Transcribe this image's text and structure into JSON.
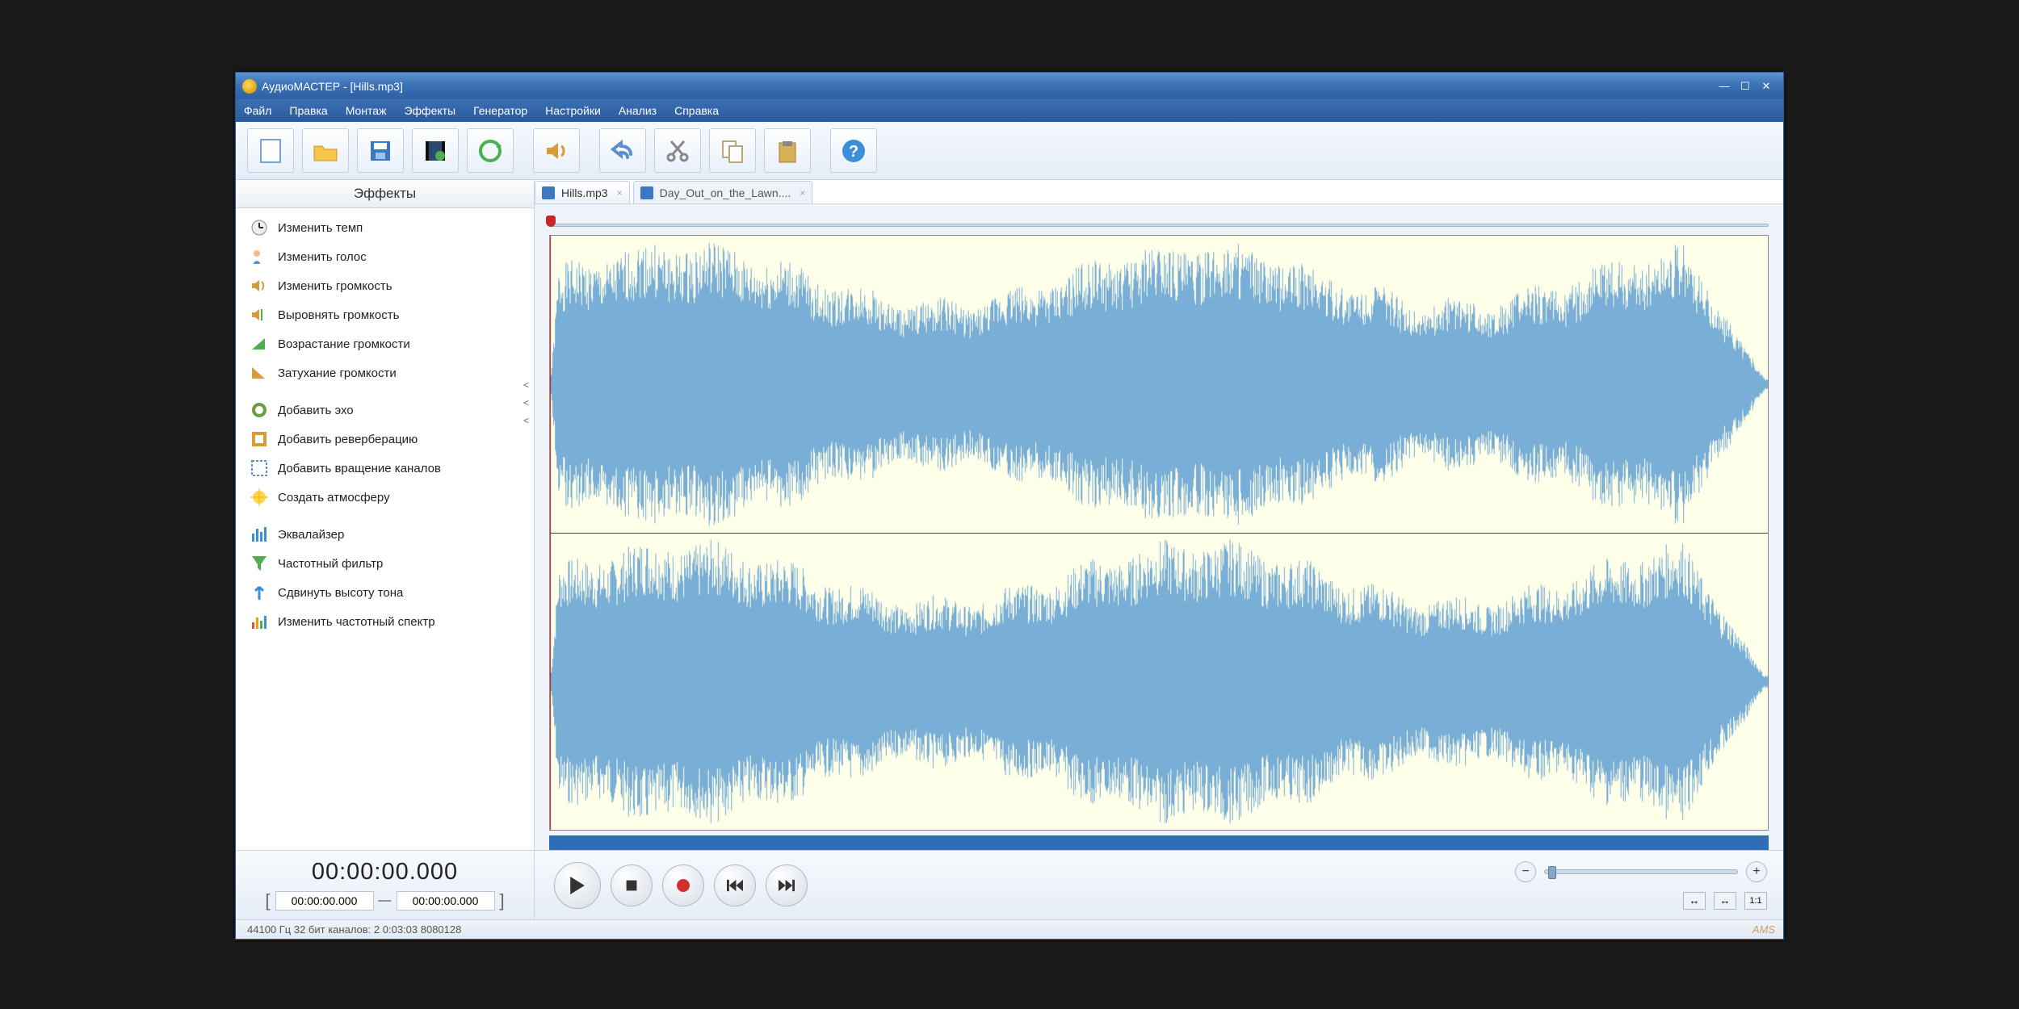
{
  "title": "АудиоМАСТЕР - [Hills.mp3]",
  "menu": [
    "Файл",
    "Правка",
    "Монтаж",
    "Эффекты",
    "Генератор",
    "Настройки",
    "Анализ",
    "Справка"
  ],
  "toolbar_icons": [
    "new",
    "open",
    "save",
    "video",
    "refresh",
    "speaker",
    "undo",
    "cut",
    "copy",
    "paste",
    "help"
  ],
  "sidebar_title": "Эффекты",
  "effects": {
    "g1": [
      {
        "label": "Изменить темп",
        "icon": "clock"
      },
      {
        "label": "Изменить голос",
        "icon": "voice"
      },
      {
        "label": "Изменить громкость",
        "icon": "vol"
      },
      {
        "label": "Выровнять громкость",
        "icon": "volnorm"
      },
      {
        "label": "Возрастание громкости",
        "icon": "fadein"
      },
      {
        "label": "Затухание громкости",
        "icon": "fadeout"
      }
    ],
    "g2": [
      {
        "label": "Добавить эхо",
        "icon": "echo"
      },
      {
        "label": "Добавить реверберацию",
        "icon": "reverb"
      },
      {
        "label": "Добавить вращение каналов",
        "icon": "rotate"
      },
      {
        "label": "Создать атмосферу",
        "icon": "atmos"
      }
    ],
    "g3": [
      {
        "label": "Эквалайзер",
        "icon": "eq"
      },
      {
        "label": "Частотный фильтр",
        "icon": "filter"
      },
      {
        "label": "Сдвинуть высоту тона",
        "icon": "pitch"
      },
      {
        "label": "Изменить частотный спектр",
        "icon": "spectrum"
      }
    ]
  },
  "tabs": [
    {
      "label": "Hills.mp3",
      "active": true
    },
    {
      "label": "Day_Out_on_the_Lawn....",
      "active": false
    }
  ],
  "time_display": "00:00:00.000",
  "range_start": "00:00:00.000",
  "range_sep": "—",
  "range_end": "00:00:00.000",
  "status": "44100 Гц  32 бит  каналов: 2   0:03:03 8080128",
  "brand": "AMS",
  "colors": {
    "wave": "#79aed6",
    "wavebg": "#feffe8"
  }
}
